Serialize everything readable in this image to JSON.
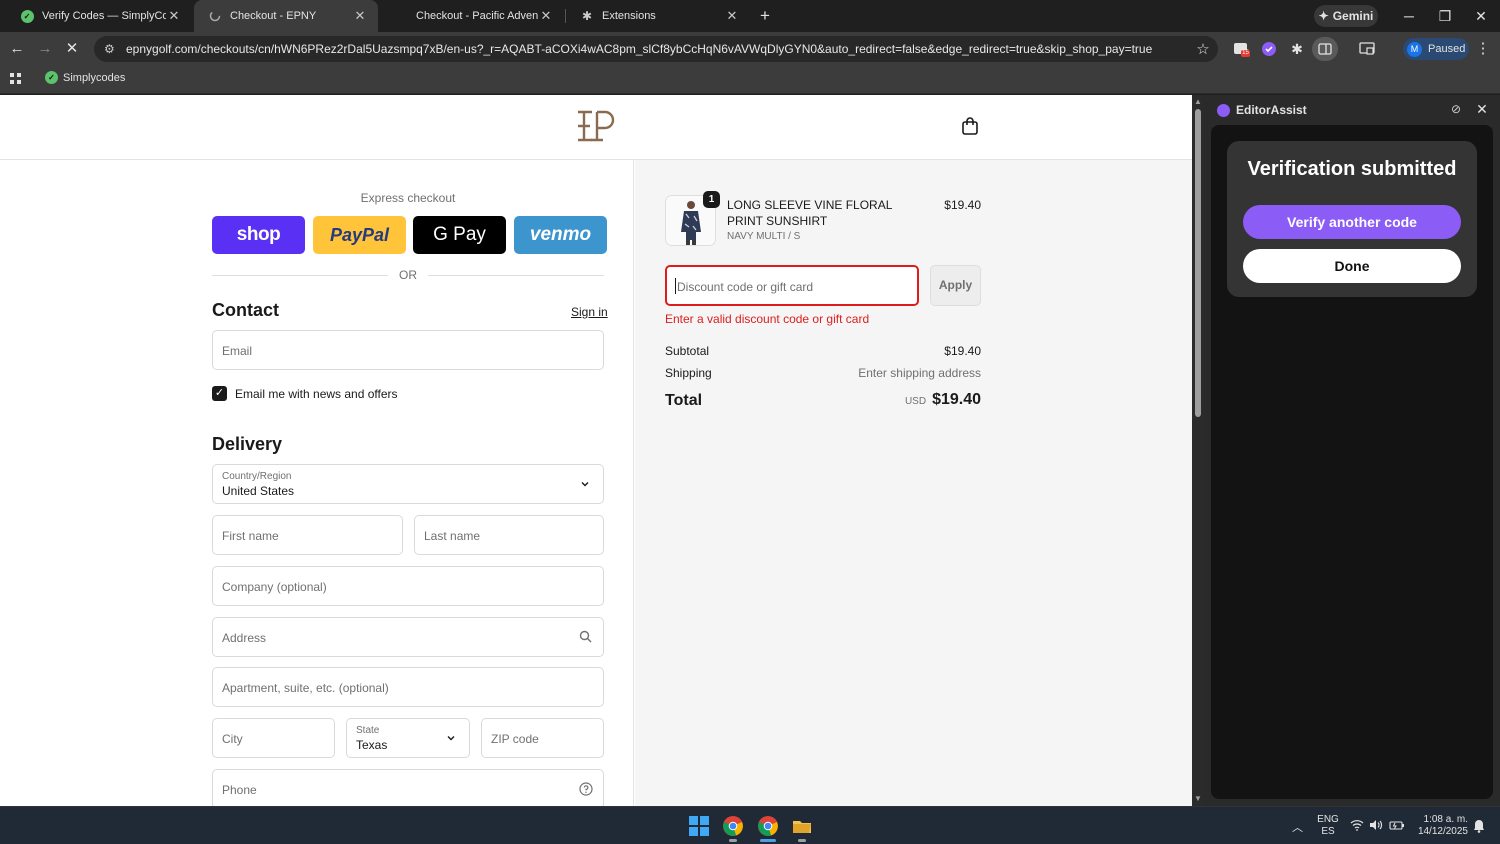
{
  "tabs": [
    {
      "label": "Verify Codes — SimplyCodes",
      "active": false
    },
    {
      "label": "Checkout - EPNY",
      "active": true
    },
    {
      "label": "Checkout - Pacific Adventure W",
      "active": false
    },
    {
      "label": "Extensions",
      "active": false
    }
  ],
  "gemini_label": "Gemini",
  "address_bar": {
    "url": "epnygolf.com/checkouts/cn/hWN6PRez2rDal5Uazsmpq7xB/en-us?_r=AQABT-aCOXi4wAC8pm_slCf8ybCcHqN6vAVWqDlyGYN0&auto_redirect=false&edge_redirect=true&skip_shop_pay=true"
  },
  "extension_badge": "15",
  "profile": {
    "initial": "M",
    "label": "Paused"
  },
  "bookmarks": [
    {
      "label": "Simplycodes"
    }
  ],
  "checkout": {
    "express_label": "Express checkout",
    "payment_buttons": [
      "shop",
      "PayPal",
      "G Pay",
      "venmo"
    ],
    "or_label": "OR",
    "contact": {
      "heading": "Contact",
      "sign_in": "Sign in",
      "email_placeholder": "Email",
      "newsletter_label": "Email me with news and offers",
      "newsletter_checked": true
    },
    "delivery": {
      "heading": "Delivery",
      "country_label": "Country/Region",
      "country_value": "United States",
      "first_name": "First name",
      "last_name": "Last name",
      "company": "Company (optional)",
      "address": "Address",
      "apartment": "Apartment, suite, etc. (optional)",
      "city": "City",
      "state_label": "State",
      "state_value": "Texas",
      "zip": "ZIP code",
      "phone": "Phone"
    }
  },
  "order": {
    "quantity": "1",
    "product_name": "LONG SLEEVE VINE FLORAL PRINT SUNSHIRT",
    "variant": "NAVY MULTI / S",
    "price": "$19.40",
    "discount_placeholder": "Discount code or gift card",
    "apply_label": "Apply",
    "discount_error": "Enter a valid discount code or gift card",
    "subtotal_label": "Subtotal",
    "subtotal_value": "$19.40",
    "shipping_label": "Shipping",
    "shipping_value": "Enter shipping address",
    "total_label": "Total",
    "total_currency": "USD",
    "total_value": "$19.40"
  },
  "side_panel": {
    "title": "EditorAssist",
    "heading": "Verification submitted",
    "verify_another": "Verify another code",
    "done": "Done"
  },
  "taskbar": {
    "lang_top": "ENG",
    "lang_bottom": "ES",
    "time": "1:08 a. m.",
    "date": "14/12/2025"
  },
  "colors": {
    "error": "#dd1d1d",
    "shop_pay": "#5a31f4",
    "paypal": "#ffc439",
    "venmo": "#3d95ce",
    "accent_purple": "#8b5cf6",
    "brand_logo": "#8a6a50"
  }
}
